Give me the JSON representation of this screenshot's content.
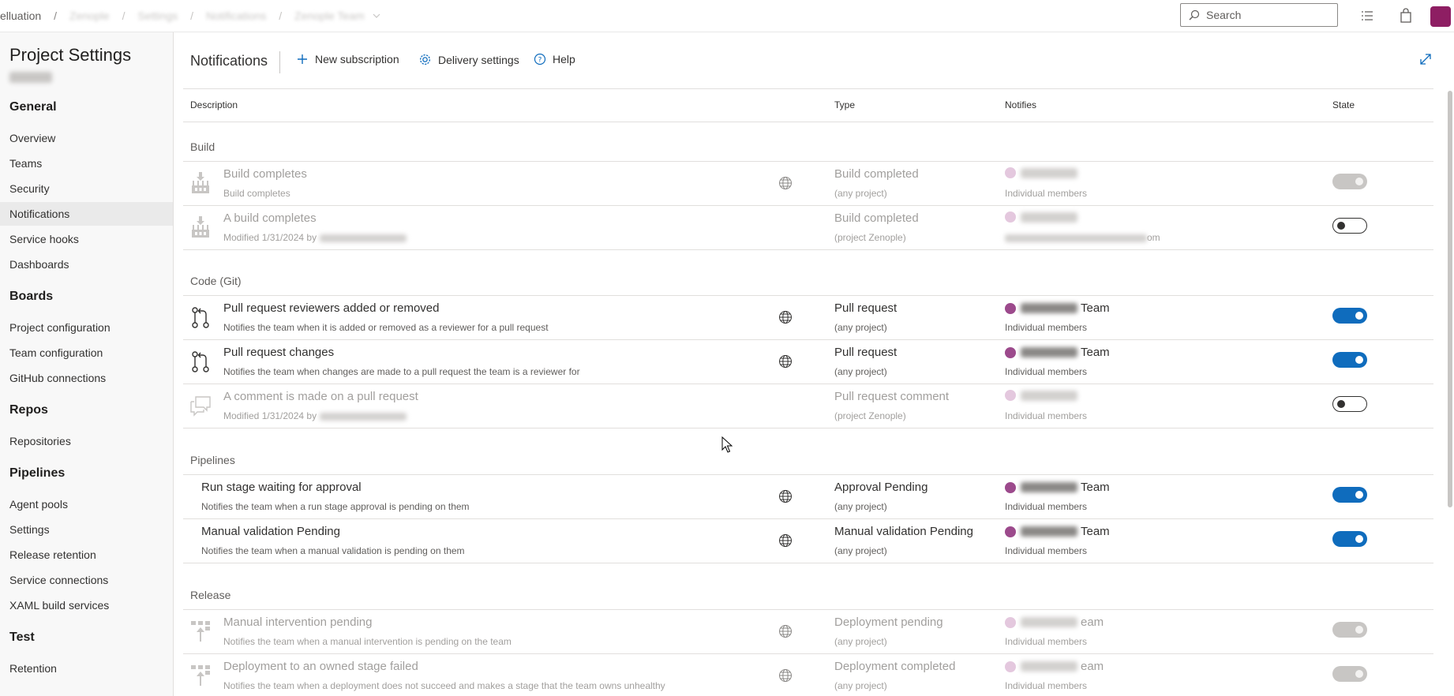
{
  "topbar": {
    "crumbs": [
      "elluation",
      "Zenople",
      "Settings",
      "Notifications",
      "Zenople Team"
    ],
    "search_placeholder": "Search"
  },
  "sidebar": {
    "title": "Project Settings",
    "sections": [
      {
        "label": "General",
        "items": [
          "Overview",
          "Teams",
          "Security",
          "Notifications",
          "Service hooks",
          "Dashboards"
        ]
      },
      {
        "label": "Boards",
        "items": [
          "Project configuration",
          "Team configuration",
          "GitHub connections"
        ]
      },
      {
        "label": "Repos",
        "items": [
          "Repositories"
        ]
      },
      {
        "label": "Pipelines",
        "items": [
          "Agent pools",
          "Settings",
          "Release retention",
          "Service connections",
          "XAML build services"
        ]
      },
      {
        "label": "Test",
        "items": [
          "Retention"
        ]
      }
    ],
    "active_item": "Notifications"
  },
  "header": {
    "title": "Notifications",
    "new_subscription": "New subscription",
    "delivery_settings": "Delivery settings",
    "help": "Help"
  },
  "table": {
    "columns": {
      "description": "Description",
      "type": "Type",
      "notifies": "Notifies",
      "state": "State"
    },
    "groups": {
      "build": "Build",
      "code": "Code (Git)",
      "pipelines": "Pipelines",
      "release": "Release"
    },
    "rows": [
      {
        "title": "Build completes",
        "sub": "Build completes",
        "type": "Build completed",
        "type_sub": "(any project)",
        "team_suffix": "",
        "notify_sub": "Individual members",
        "state": "disabled"
      },
      {
        "title": "A build completes",
        "sub": "Modified 1/31/2024 by",
        "type": "Build completed",
        "type_sub": "(project Zenople)",
        "team_suffix": "",
        "notify_sub": "om",
        "state": "off"
      },
      {
        "title": "Pull request reviewers added or removed",
        "sub": "Notifies the team when it is added or removed as a reviewer for a pull request",
        "type": "Pull request",
        "type_sub": "(any project)",
        "team_suffix": "Team",
        "notify_sub": "Individual members",
        "state": "on"
      },
      {
        "title": "Pull request changes",
        "sub": "Notifies the team when changes are made to a pull request the team is a reviewer for",
        "type": "Pull request",
        "type_sub": "(any project)",
        "team_suffix": "Team",
        "notify_sub": "Individual members",
        "state": "on"
      },
      {
        "title": "A comment is made on a pull request",
        "sub": "Modified 1/31/2024 by",
        "type": "Pull request comment",
        "type_sub": "(project Zenople)",
        "team_suffix": "",
        "notify_sub": "Individual members",
        "state": "off"
      },
      {
        "title": "Run stage waiting for approval",
        "sub": "Notifies the team when a run stage approval is pending on them",
        "type": "Approval Pending",
        "type_sub": "(any project)",
        "team_suffix": "Team",
        "notify_sub": "Individual members",
        "state": "on"
      },
      {
        "title": "Manual validation Pending",
        "sub": "Notifies the team when a manual validation is pending on them",
        "type": "Manual validation Pending",
        "type_sub": "(any project)",
        "team_suffix": "Team",
        "notify_sub": "Individual members",
        "state": "on"
      },
      {
        "title": "Manual intervention pending",
        "sub": "Notifies the team when a manual intervention is pending on the team",
        "type": "Deployment pending",
        "type_sub": "(any project)",
        "team_suffix": "eam",
        "notify_sub": "Individual members",
        "state": "disabled"
      },
      {
        "title": "Deployment to an owned stage failed",
        "sub": "Notifies the team when a deployment does not succeed and makes a stage that the team owns unhealthy",
        "type": "Deployment completed",
        "type_sub": "(any project)",
        "team_suffix": "eam",
        "notify_sub": "Individual members",
        "state": "disabled"
      }
    ]
  },
  "colors": {
    "accent": "#0f6cbd",
    "avatar": "#8e1e63"
  }
}
